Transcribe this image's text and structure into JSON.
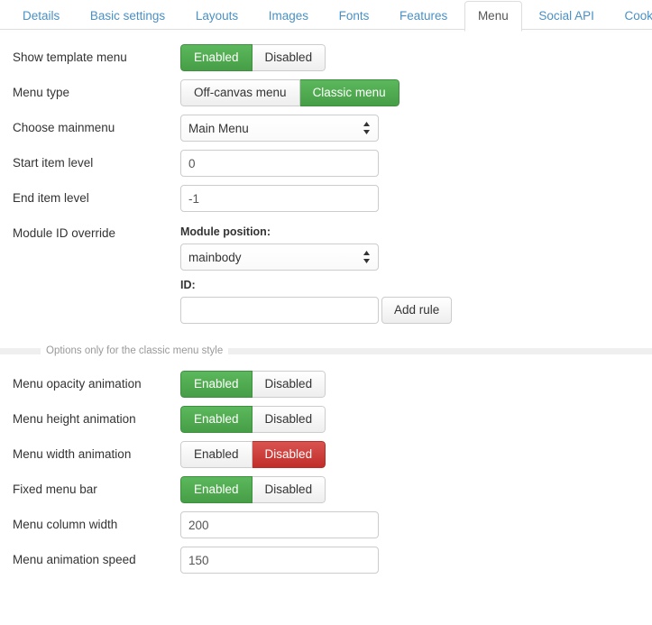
{
  "tabs": [
    {
      "label": "Details",
      "active": false
    },
    {
      "label": "Basic settings",
      "active": false
    },
    {
      "label": "Layouts",
      "active": false
    },
    {
      "label": "Images",
      "active": false
    },
    {
      "label": "Fonts",
      "active": false
    },
    {
      "label": "Features",
      "active": false
    },
    {
      "label": "Menu",
      "active": true
    },
    {
      "label": "Social API",
      "active": false
    },
    {
      "label": "Cookie Law",
      "active": false
    }
  ],
  "rows": {
    "show_template_menu": {
      "label": "Show template menu",
      "options": [
        "Enabled",
        "Disabled"
      ],
      "selected": "Enabled"
    },
    "menu_type": {
      "label": "Menu type",
      "options": [
        "Off-canvas menu",
        "Classic menu"
      ],
      "selected": "Classic menu"
    },
    "choose_mainmenu": {
      "label": "Choose mainmenu",
      "value": "Main Menu"
    },
    "start_item_level": {
      "label": "Start item level",
      "value": "0"
    },
    "end_item_level": {
      "label": "End item level",
      "value": "-1"
    },
    "module_id_override": {
      "label": "Module ID override",
      "module_position_label": "Module position:",
      "module_position_value": "mainbody",
      "id_label": "ID:",
      "id_value": "",
      "add_rule_label": "Add rule"
    },
    "menu_opacity_animation": {
      "label": "Menu opacity animation",
      "options": [
        "Enabled",
        "Disabled"
      ],
      "selected": "Enabled"
    },
    "menu_height_animation": {
      "label": "Menu height animation",
      "options": [
        "Enabled",
        "Disabled"
      ],
      "selected": "Enabled"
    },
    "menu_width_animation": {
      "label": "Menu width animation",
      "options": [
        "Enabled",
        "Disabled"
      ],
      "selected": "Disabled"
    },
    "fixed_menu_bar": {
      "label": "Fixed menu bar",
      "options": [
        "Enabled",
        "Disabled"
      ],
      "selected": "Enabled"
    },
    "menu_column_width": {
      "label": "Menu column width",
      "value": "200"
    },
    "menu_animation_speed": {
      "label": "Menu animation speed",
      "value": "150"
    }
  },
  "divider": {
    "text": "Options only for the classic menu style"
  },
  "colors": {
    "enabled_green": "#5cb85c",
    "disabled_red": "#d9534f",
    "tab_link": "#4a90c4",
    "border": "#cccccc"
  }
}
